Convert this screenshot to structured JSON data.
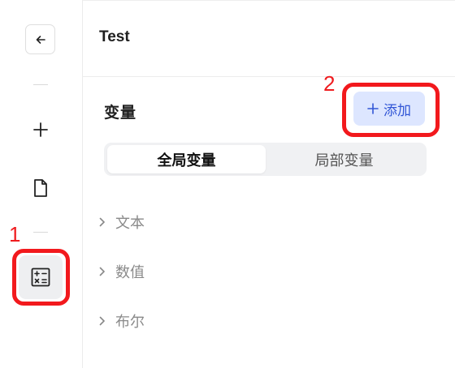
{
  "header": {
    "title": "Test"
  },
  "sidebar": {
    "icons": [
      "arrow-left-icon",
      "plus-icon",
      "document-icon",
      "calculator-icon"
    ]
  },
  "variables": {
    "section_title": "变量",
    "add_label": "添加",
    "tabs": [
      {
        "label": "全局变量",
        "active": true
      },
      {
        "label": "局部变量",
        "active": false
      }
    ],
    "groups": [
      {
        "label": "文本"
      },
      {
        "label": "数值"
      },
      {
        "label": "布尔"
      }
    ]
  },
  "annotations": [
    {
      "label": "1"
    },
    {
      "label": "2"
    }
  ],
  "colors": {
    "highlight": "#f2191d",
    "accent": "#3256d6",
    "accent_bg": "#dde6ff"
  }
}
